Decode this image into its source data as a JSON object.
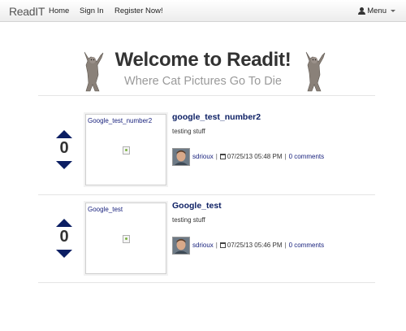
{
  "navbar": {
    "brand": "ReadIT",
    "links": [
      "Home",
      "Sign In",
      "Register Now!"
    ],
    "menu_label": "Menu"
  },
  "hero": {
    "title": "Welcome to Readit!",
    "tagline": "Where Cat Pictures Go To Die"
  },
  "posts": [
    {
      "votes": "0",
      "thumb_alt": "Google_test_number2",
      "title": "google_test_number2",
      "body": "testing stuff",
      "author": "sdrioux",
      "date": "07/25/13 05:48 PM",
      "comments": "0 comments"
    },
    {
      "votes": "0",
      "thumb_alt": "Google_test",
      "title": "Google_test",
      "body": "testing stuff",
      "author": "sdrioux",
      "date": "07/25/13 05:46 PM",
      "comments": "0 comments"
    }
  ],
  "colors": {
    "vote_arrow": "#0b1e63",
    "title_link": "#0b1e63",
    "tagline": "#9a9a9a"
  },
  "icons": [
    "user-icon",
    "caret-down-icon",
    "calendar-icon",
    "broken-image-icon",
    "dancing-cat-image"
  ]
}
